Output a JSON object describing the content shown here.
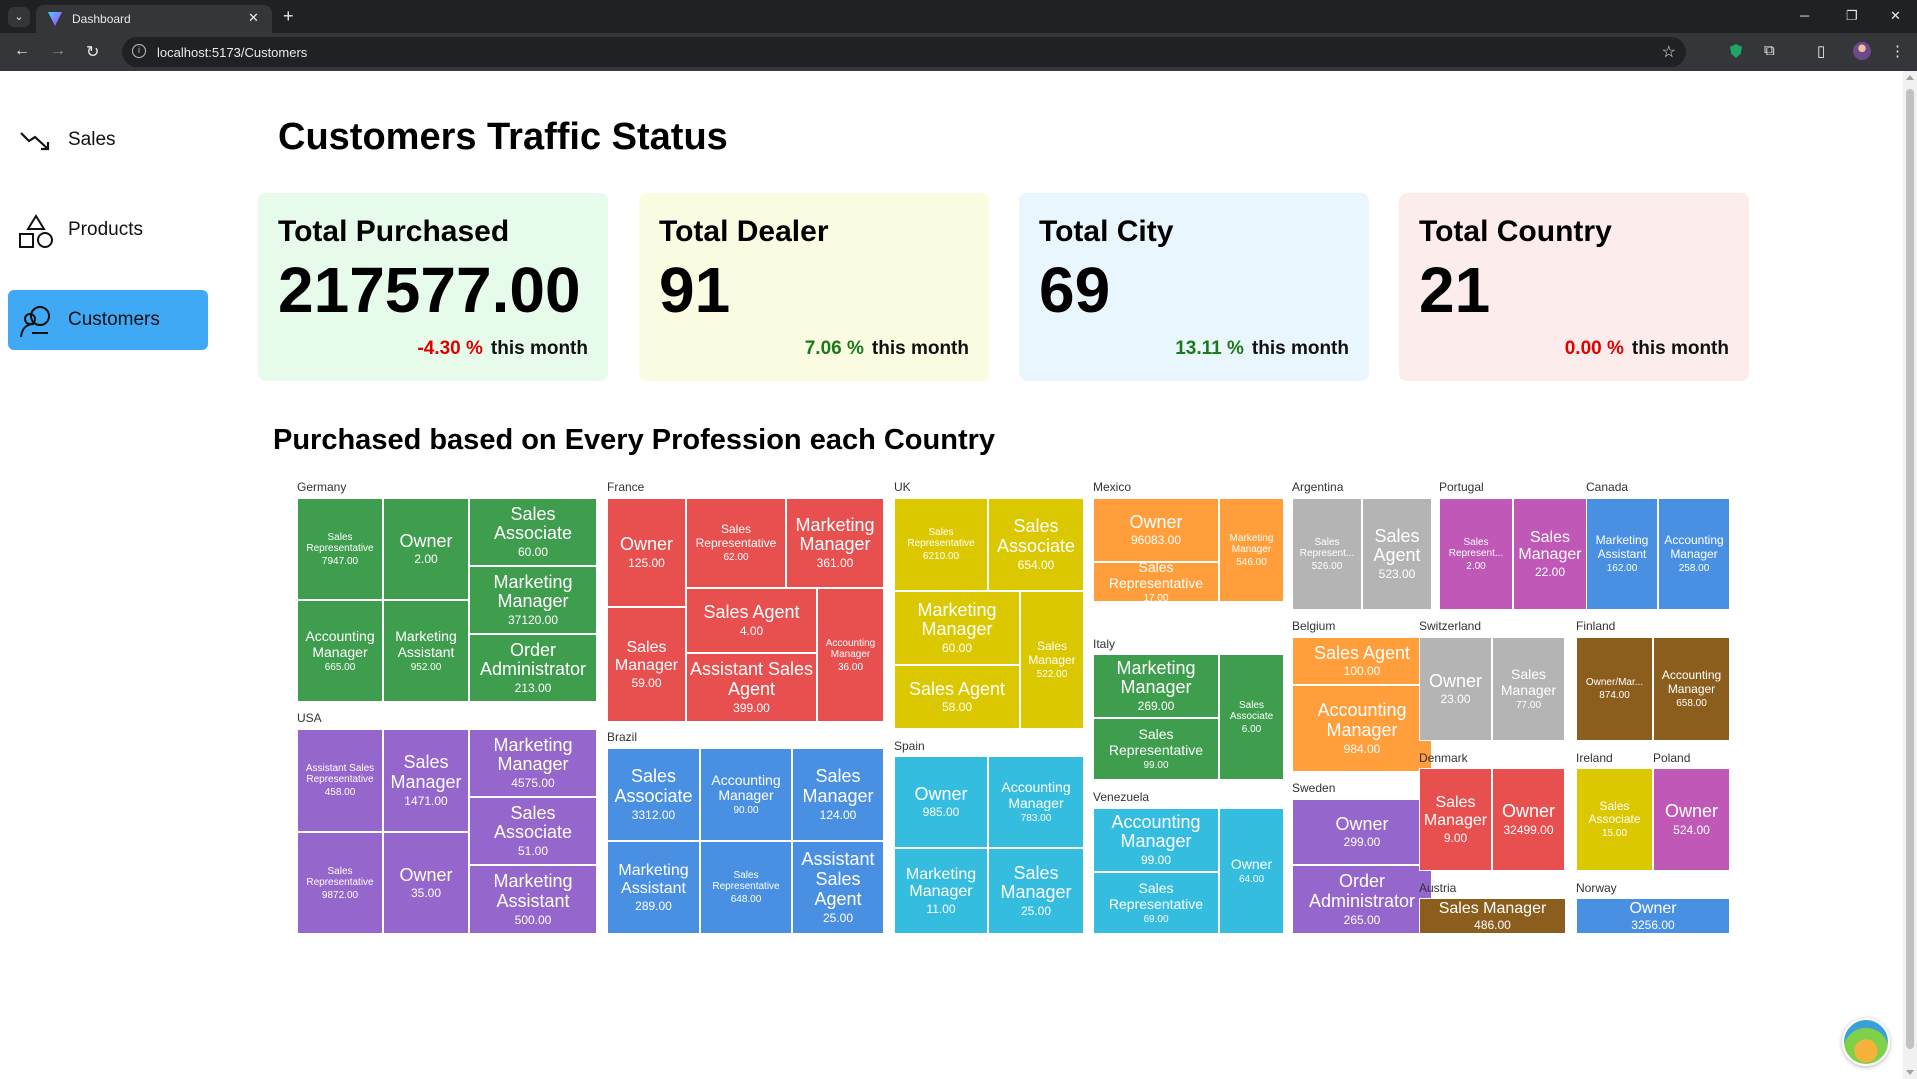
{
  "browser": {
    "tab_title": "Dashboard",
    "url": "localhost:5173/Customers"
  },
  "sidebar": {
    "items": [
      {
        "label": "Sales",
        "icon": "chart-trend-down-icon",
        "active": false
      },
      {
        "label": "Products",
        "icon": "shapes-icon",
        "active": false
      },
      {
        "label": "Customers",
        "icon": "customer-icon",
        "active": true
      }
    ]
  },
  "main": {
    "title": "Customers Traffic Status",
    "cards": [
      {
        "title": "Total Purchased",
        "value": "217577.00",
        "pct": "-4.30 %",
        "period": "this month",
        "bg": "#e6fbea"
      },
      {
        "title": "Total Dealer",
        "value": "91",
        "pct": "7.06 %",
        "period": "this month",
        "bg": "#fafbe1"
      },
      {
        "title": "Total City",
        "value": "69",
        "pct": "13.11 %",
        "period": "this month",
        "bg": "#eaf6fd"
      },
      {
        "title": "Total Country",
        "value": "21",
        "pct": "0.00 %",
        "period": "this month",
        "bg": "#fdecec"
      }
    ],
    "section_title": "Purchased based on Every Profession each Country"
  },
  "chart_data": {
    "type": "treemap",
    "colors": {
      "Germany": "#3f9e4d",
      "France": "#e85050",
      "UK": "#dcc800",
      "Mexico": "#ff9e3a",
      "Argentina": "#b4b4b4",
      "Portugal": "#c058b8",
      "Canada": "#4a90e2",
      "USA": "#9566cc",
      "Brazil": "#4a90e2",
      "Spain": "#35bde0",
      "Italy": "#3f9e4d",
      "Venezuela": "#35bde0",
      "Belgium": "#ff9e3a",
      "Sweden": "#9566cc",
      "Switzerland": "#b4b4b4",
      "Finland": "#8b5e1e",
      "Denmark": "#e85050",
      "Ireland": "#dcc800",
      "Poland": "#c058b8",
      "Austria": "#8b5e1e",
      "Norway": "#4a90e2"
    },
    "groups": [
      {
        "country": "Germany",
        "items": [
          {
            "name": "Sales Representative",
            "value": "7947.00"
          },
          {
            "name": "Owner",
            "value": "2.00"
          },
          {
            "name": "Sales Associate",
            "value": "60.00"
          },
          {
            "name": "Marketing Manager",
            "value": "37120.00"
          },
          {
            "name": "Accounting Manager",
            "value": "665.00"
          },
          {
            "name": "Marketing Assistant",
            "value": "952.00"
          },
          {
            "name": "Order Administrator",
            "value": "213.00"
          }
        ]
      },
      {
        "country": "USA",
        "items": [
          {
            "name": "Assistant Sales Representative",
            "value": "458.00"
          },
          {
            "name": "Sales Manager",
            "value": "1471.00"
          },
          {
            "name": "Marketing Manager",
            "value": "4575.00"
          },
          {
            "name": "Sales Associate",
            "value": "51.00"
          },
          {
            "name": "Sales Representative",
            "value": "9872.00"
          },
          {
            "name": "Owner",
            "value": "35.00"
          },
          {
            "name": "Marketing Assistant",
            "value": "500.00"
          }
        ]
      },
      {
        "country": "France",
        "items": [
          {
            "name": "Owner",
            "value": "125.00"
          },
          {
            "name": "Sales Representative",
            "value": "62.00"
          },
          {
            "name": "Marketing Manager",
            "value": "361.00"
          },
          {
            "name": "Sales Agent",
            "value": "4.00"
          },
          {
            "name": "Sales Manager",
            "value": "59.00"
          },
          {
            "name": "Accounting Manager",
            "value": "36.00"
          },
          {
            "name": "Assistant Sales Agent",
            "value": "399.00"
          }
        ]
      },
      {
        "country": "Brazil",
        "items": [
          {
            "name": "Sales Associate",
            "value": "3312.00"
          },
          {
            "name": "Accounting Manager",
            "value": "90.00"
          },
          {
            "name": "Sales Manager",
            "value": "124.00"
          },
          {
            "name": "Marketing Assistant",
            "value": "289.00"
          },
          {
            "name": "Sales Representative",
            "value": "648.00"
          },
          {
            "name": "Assistant Sales Agent",
            "value": "25.00"
          }
        ]
      },
      {
        "country": "UK",
        "items": [
          {
            "name": "Sales Representative",
            "value": "6210.00"
          },
          {
            "name": "Sales Associate",
            "value": "654.00"
          },
          {
            "name": "Marketing Manager",
            "value": "60.00"
          },
          {
            "name": "Sales Manager",
            "value": "522.00"
          },
          {
            "name": "Sales Agent",
            "value": "58.00"
          }
        ]
      },
      {
        "country": "Spain",
        "items": [
          {
            "name": "Owner",
            "value": "985.00"
          },
          {
            "name": "Accounting Manager",
            "value": "783.00"
          },
          {
            "name": "Marketing Manager",
            "value": "11.00"
          },
          {
            "name": "Sales Manager",
            "value": "25.00"
          }
        ]
      },
      {
        "country": "Mexico",
        "items": [
          {
            "name": "Owner",
            "value": "96083.00"
          },
          {
            "name": "Marketing Manager",
            "value": "546.00"
          },
          {
            "name": "Sales Representative",
            "value": "17.00"
          }
        ]
      },
      {
        "country": "Italy",
        "items": [
          {
            "name": "Marketing Manager",
            "value": "269.00"
          },
          {
            "name": "Sales Associate",
            "value": "6.00"
          },
          {
            "name": "Sales Representative",
            "value": "99.00"
          }
        ]
      },
      {
        "country": "Venezuela",
        "items": [
          {
            "name": "Accounting Manager",
            "value": "99.00"
          },
          {
            "name": "Owner",
            "value": "64.00"
          },
          {
            "name": "Sales Representative",
            "value": "69.00"
          }
        ]
      },
      {
        "country": "Argentina",
        "items": [
          {
            "name": "Sales Represent...",
            "value": "526.00"
          },
          {
            "name": "Sales Agent",
            "value": "523.00"
          }
        ]
      },
      {
        "country": "Belgium",
        "items": [
          {
            "name": "Sales Agent",
            "value": "100.00"
          },
          {
            "name": "Accounting Manager",
            "value": "984.00"
          }
        ]
      },
      {
        "country": "Sweden",
        "items": [
          {
            "name": "Owner",
            "value": "299.00"
          },
          {
            "name": "Order Administrator",
            "value": "265.00"
          }
        ]
      },
      {
        "country": "Portugal",
        "items": [
          {
            "name": "Sales Represent...",
            "value": "2.00"
          },
          {
            "name": "Sales Manager",
            "value": "22.00"
          }
        ]
      },
      {
        "country": "Switzerland",
        "items": [
          {
            "name": "Owner",
            "value": "23.00"
          },
          {
            "name": "Sales Manager",
            "value": "77.00"
          }
        ]
      },
      {
        "country": "Denmark",
        "items": [
          {
            "name": "Sales Manager",
            "value": "9.00"
          },
          {
            "name": "Owner",
            "value": "32499.00"
          }
        ]
      },
      {
        "country": "Austria",
        "items": [
          {
            "name": "Sales Manager",
            "value": "486.00"
          }
        ]
      },
      {
        "country": "Canada",
        "items": [
          {
            "name": "Marketing Assistant",
            "value": "162.00"
          },
          {
            "name": "Accounting Manager",
            "value": "258.00"
          }
        ]
      },
      {
        "country": "Finland",
        "items": [
          {
            "name": "Owner/Mar...",
            "value": "874.00"
          },
          {
            "name": "Accounting Manager",
            "value": "658.00"
          }
        ]
      },
      {
        "country": "Ireland",
        "items": [
          {
            "name": "Sales Associate",
            "value": "15.00"
          }
        ]
      },
      {
        "country": "Poland",
        "items": [
          {
            "name": "Owner",
            "value": "524.00"
          }
        ]
      },
      {
        "country": "Norway",
        "items": [
          {
            "name": "Owner",
            "value": "3256.00"
          }
        ]
      }
    ]
  }
}
